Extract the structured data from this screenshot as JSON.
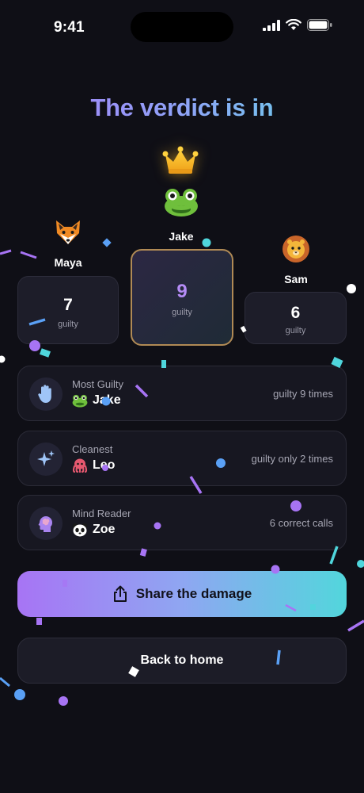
{
  "status_bar": {
    "time": "9:41"
  },
  "title": "The verdict is in",
  "players": [
    {
      "name": "Maya",
      "count": "7",
      "label": "guilty",
      "emoji": "fox-face"
    },
    {
      "name": "Jake",
      "count": "9",
      "label": "guilty",
      "emoji": "frog-face",
      "winner": true
    },
    {
      "name": "Sam",
      "count": "6",
      "label": "guilty",
      "emoji": "lion-face"
    }
  ],
  "awards": [
    {
      "title": "Most Guilty",
      "winner": "Jake",
      "stat": "guilty 9 times",
      "icon": "raised-hand-icon",
      "avatar": "frog-face"
    },
    {
      "title": "Cleanest",
      "winner": "Leo",
      "stat": "guilty only 2 times",
      "icon": "sparkles-icon",
      "avatar": "octopus"
    },
    {
      "title": "Mind Reader",
      "winner": "Zoe",
      "stat": "6 correct calls",
      "icon": "brain-head-icon",
      "avatar": "panda-face"
    }
  ],
  "actions": {
    "share_label": "Share the damage",
    "home_label": "Back to home"
  },
  "colors": {
    "background": "#0f0f16",
    "accent_purple": "#a774f4",
    "accent_cyan": "#52d6dc",
    "winner_border": "#b08a55"
  }
}
